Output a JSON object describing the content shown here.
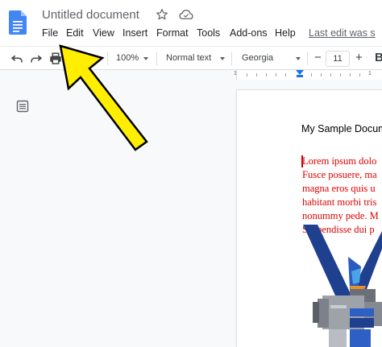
{
  "app": {
    "title": "Untitled document",
    "last_edit": "Last edit was s"
  },
  "menu": [
    {
      "label": "File"
    },
    {
      "label": "Edit"
    },
    {
      "label": "View"
    },
    {
      "label": "Insert"
    },
    {
      "label": "Format"
    },
    {
      "label": "Tools"
    },
    {
      "label": "Add-ons"
    },
    {
      "label": "Help"
    }
  ],
  "toolbar": {
    "zoom": "100%",
    "style": "Normal text",
    "font": "Georgia",
    "minus": "−",
    "font_size": "11",
    "plus": "+",
    "bold_partial": "B"
  },
  "ruler": {
    "numbers": [
      "1",
      "1"
    ]
  },
  "document": {
    "heading": "My Sample Docum",
    "body_lines": [
      "Lorem ipsum dolo",
      "Fusce posuere, ma",
      "magna eros quis u",
      "habitant morbi tris",
      "nonummy pede. M",
      "Suspendisse dui p"
    ]
  },
  "icons": {
    "logo": "google-docs-logo",
    "star": "star-outline-icon",
    "cloud": "cloud-done-icon",
    "undo": "undo-icon",
    "redo": "redo-icon",
    "print": "print-icon",
    "outline": "document-outline-icon",
    "annotation": "yellow-arrow-pointing-to-file-menu"
  },
  "colors": {
    "brand_blue": "#4285f4",
    "body_text_red": "#e00000",
    "annotation_yellow": "#ffee00"
  }
}
